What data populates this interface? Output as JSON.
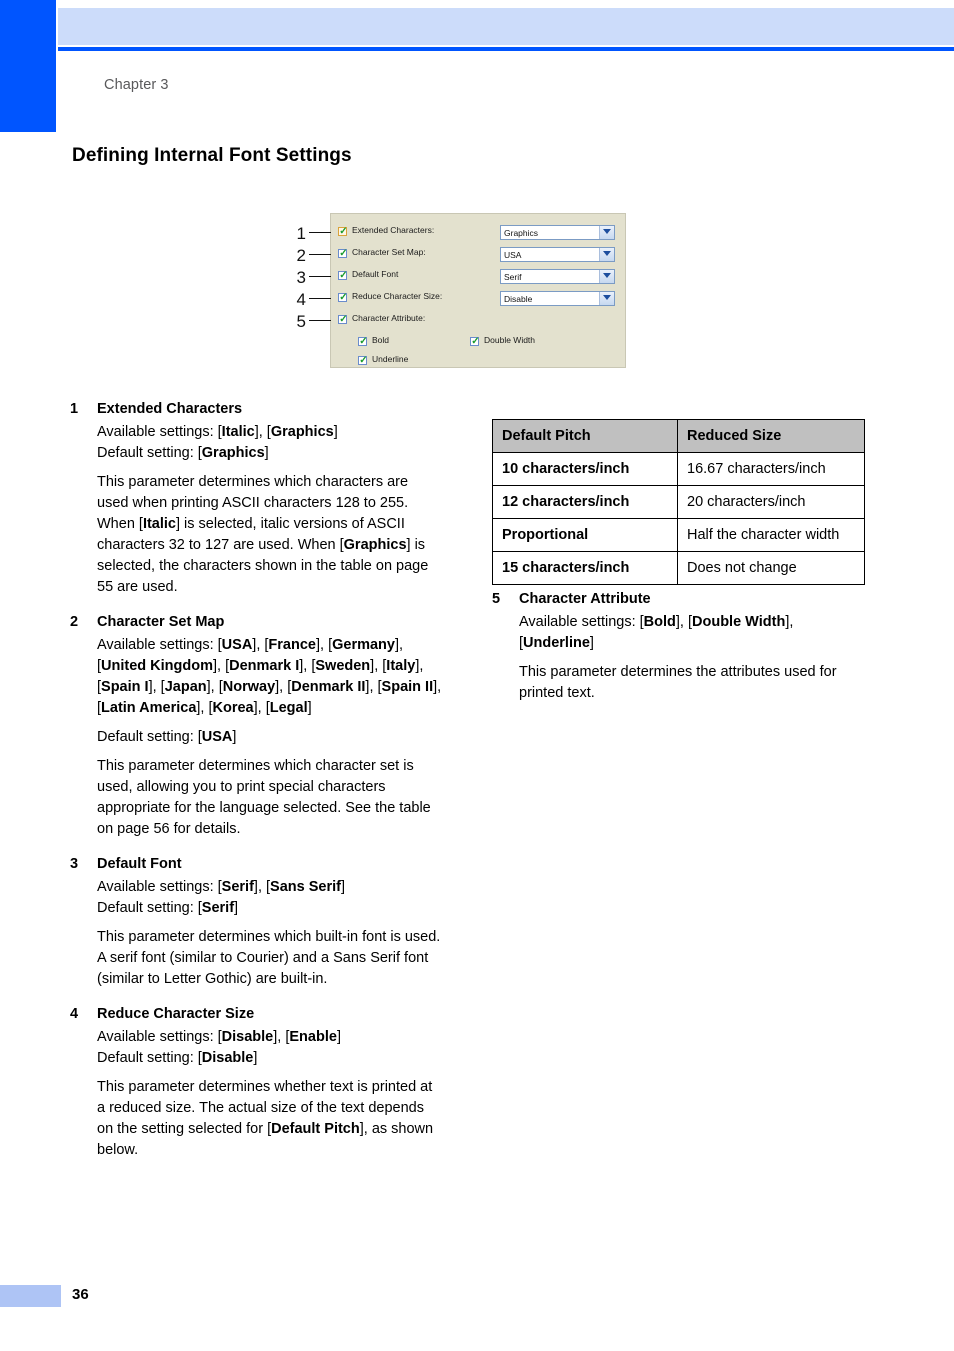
{
  "header": {
    "chapter": "Chapter 3",
    "title": "Defining Internal Font Settings",
    "accent_color": "#0055ff",
    "banner_color": "#ccdcfa"
  },
  "footer": {
    "page_number": "36",
    "block_color": "#aec4f5"
  },
  "figure": {
    "callouts": [
      "1",
      "2",
      "3",
      "4",
      "5"
    ],
    "panel_bg": "#e3e1ce",
    "rows": [
      {
        "label": "Extended Characters:",
        "checked": true,
        "focused": true,
        "value": "Graphics"
      },
      {
        "label": "Character Set Map:",
        "checked": true,
        "focused": false,
        "value": "USA"
      },
      {
        "label": "Default Font",
        "checked": true,
        "focused": false,
        "value": "Serif"
      },
      {
        "label": "Reduce Character Size:",
        "checked": true,
        "focused": false,
        "value": "Disable"
      },
      {
        "label": "Character Attribute:",
        "checked": true,
        "focused": false,
        "value": ""
      }
    ],
    "attributes": [
      {
        "label": "Bold",
        "checked": true
      },
      {
        "label": "Double Width",
        "checked": true
      },
      {
        "label": "Underline",
        "checked": true
      }
    ]
  },
  "left_column": {
    "items": [
      {
        "num": "1",
        "title": "Extended Characters",
        "available_html": "Available settings: [<b>Italic</b>], [<b>Graphics</b>]",
        "default_html": "Default setting: [<b>Graphics</b>]",
        "description_html": "This parameter determines which characters are used when printing ASCII characters 128 to 255. When [<b>Italic</b>] is selected, italic versions of ASCII characters 32 to 127 are used. When [<b>Graphics</b>] is selected, the characters shown in the table on page 55 are used."
      },
      {
        "num": "2",
        "title": "Character Set Map",
        "available_html": "Available settings: [<b>USA</b>], [<b>France</b>], [<b>Germany</b>], [<b>United Kingdom</b>], [<b>Denmark I</b>], [<b>Sweden</b>], [<b>Italy</b>], [<b>Spain I</b>], [<b>Japan</b>], [<b>Norway</b>], [<b>Denmark II</b>], [<b>Spain II</b>], [<b>Latin America</b>], [<b>Korea</b>], [<b>Legal</b>]",
        "default_html": "Default setting: [<b>USA</b>]",
        "description_html": "This parameter determines which character set is used, allowing you to print special characters appropriate for the language selected. See the table on page 56 for details."
      },
      {
        "num": "3",
        "title": "Default Font",
        "available_html": "Available settings: [<b>Serif</b>], [<b>Sans Serif</b>]",
        "default_html": "Default setting: [<b>Serif</b>]",
        "description_html": "This parameter determines which built-in font is used. A serif font (similar to Courier) and a Sans Serif font (similar to Letter Gothic) are built-in."
      },
      {
        "num": "4",
        "title": "Reduce Character Size",
        "available_html": "Available settings: [<b>Disable</b>], [<b>Enable</b>]",
        "default_html": "Default setting: [<b>Disable</b>]",
        "description_html": "This parameter determines whether text is printed at a reduced size. The actual size of the text depends on the setting selected for [<b>Default Pitch</b>], as shown below."
      }
    ]
  },
  "right_column": {
    "table": {
      "headers": [
        "Default Pitch",
        "Reduced Size"
      ],
      "rows": [
        [
          "10 characters/inch",
          "16.67 characters/inch"
        ],
        [
          "12 characters/inch",
          "20 characters/inch"
        ],
        [
          "Proportional",
          "Half the character width"
        ],
        [
          "15 characters/inch",
          "Does not change"
        ]
      ]
    },
    "item": {
      "num": "5",
      "title": "Character Attribute",
      "available_html": "Available settings: [<b>Bold</b>], [<b>Double Width</b>], [<b>Underline</b>]",
      "description_html": "This parameter determines the attributes used for printed text."
    }
  }
}
